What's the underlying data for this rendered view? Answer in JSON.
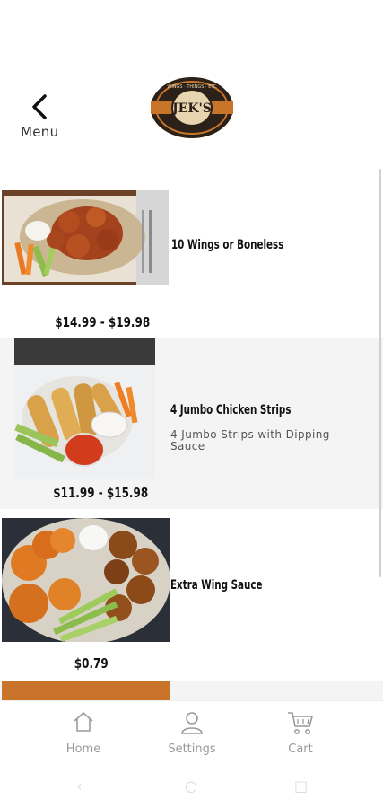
{
  "header": {
    "back_label": "Menu",
    "logo_text": "JEK'S",
    "logo_ring_text": "WINGS · THINGS · ETC"
  },
  "items": [
    {
      "name": "10 Wings or Boneless",
      "description": "",
      "price": "$14.99 - $19.98"
    },
    {
      "name": "4 Jumbo Chicken Strips",
      "description": "4  Jumbo Strips with Dipping Sauce",
      "price": "$11.99 - $15.98"
    },
    {
      "name": "Extra Wing Sauce",
      "description": "",
      "price": "$0.79"
    }
  ],
  "tabs": [
    {
      "label": "Home",
      "icon": "home-icon"
    },
    {
      "label": "Settings",
      "icon": "user-icon"
    },
    {
      "label": "Cart",
      "icon": "cart-icon"
    }
  ],
  "colors": {
    "accent": "#c8752a",
    "logo_dark": "#2b2118",
    "alt_row": "#f4f4f4",
    "tab_inactive": "#9a9a9a"
  }
}
